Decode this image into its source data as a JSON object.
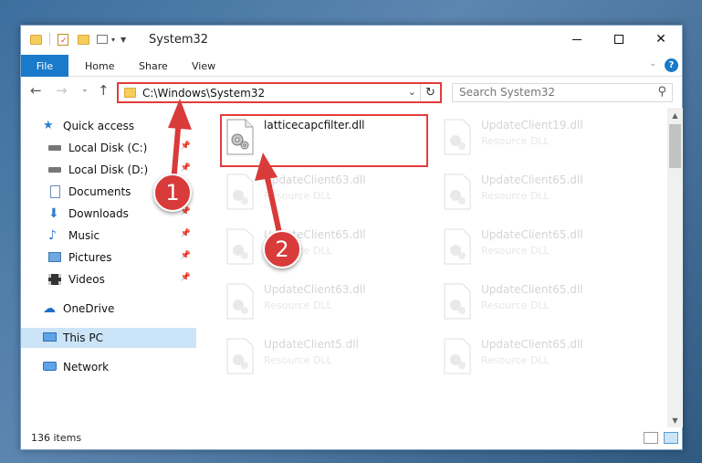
{
  "window": {
    "title": "System32"
  },
  "ribbon": {
    "tabs": [
      {
        "label": "File"
      },
      {
        "label": "Home"
      },
      {
        "label": "Share"
      },
      {
        "label": "View"
      }
    ],
    "help_icon": "?"
  },
  "navigation": {
    "address": "C:\\Windows\\System32",
    "search_placeholder": "Search System32"
  },
  "sidebar": {
    "items": [
      {
        "label": "Quick access",
        "icon": "star-icon"
      },
      {
        "label": "Local Disk (C:)",
        "icon": "drive-icon",
        "pinned": true
      },
      {
        "label": "Local Disk (D:)",
        "icon": "drive-icon",
        "pinned": true
      },
      {
        "label": "Documents",
        "icon": "documents-icon",
        "pinned": true
      },
      {
        "label": "Downloads",
        "icon": "download-icon",
        "pinned": true
      },
      {
        "label": "Music",
        "icon": "music-icon",
        "pinned": true
      },
      {
        "label": "Pictures",
        "icon": "pictures-icon",
        "pinned": true
      },
      {
        "label": "Videos",
        "icon": "videos-icon",
        "pinned": true
      },
      {
        "label": "OneDrive",
        "icon": "cloud-icon"
      },
      {
        "label": "This PC",
        "icon": "computer-icon",
        "selected": true
      },
      {
        "label": "Network",
        "icon": "network-icon"
      }
    ]
  },
  "files": [
    {
      "name": "latticecapcfilter.dll",
      "type": "",
      "highlighted": true
    },
    {
      "name": "UpdateClient19.dll",
      "type": "Resource DLL"
    },
    {
      "name": "UpdateClient63.dll",
      "type": "Resource DLL"
    },
    {
      "name": "UpdateClient65.dll",
      "type": "Resource DLL"
    },
    {
      "name": "UpdateClient65.dll",
      "type": "Resource DLL"
    },
    {
      "name": "UpdateClient65.dll",
      "type": "Resource DLL"
    },
    {
      "name": "UpdateClient63.dll",
      "type": "Resource DLL"
    },
    {
      "name": "UpdateClient65.dll",
      "type": "Resource DLL"
    },
    {
      "name": "UpdateClient5.dll",
      "type": "Resource DLL"
    },
    {
      "name": "UpdateClient65.dll",
      "type": "Resource DLL"
    }
  ],
  "status": {
    "item_count": "136 items"
  },
  "annotations": [
    {
      "label": "1"
    },
    {
      "label": "2"
    }
  ],
  "colors": {
    "accent": "#1979ca",
    "highlight": "#e23c3c",
    "selection": "#cce4f7"
  }
}
